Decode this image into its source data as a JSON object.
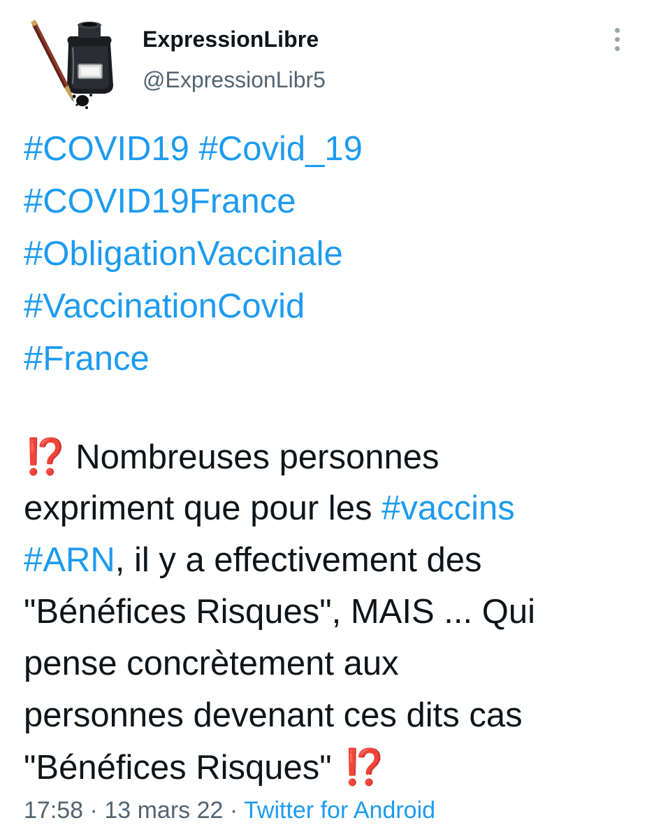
{
  "author": {
    "name": "ExpressionLibre",
    "handle": "@ExpressionLibr5",
    "avatar_icon": "fountain-pen-inkwell-icon"
  },
  "menu_icon": "more-vertical-icon",
  "colors": {
    "link": "#1d9bf0",
    "text": "#0f1419",
    "secondary": "#536471",
    "emoji": "#d0103a"
  },
  "hashtags": [
    [
      "#COVID19",
      "#Covid_19"
    ],
    [
      "#COVID19France"
    ],
    [
      "#ObligationVaccinale"
    ],
    [
      "#VaccinationCovid"
    ],
    [
      "#France"
    ]
  ],
  "body": {
    "emoji": "⁉️",
    "line1": "Nombreuses personnes",
    "line2_text": "expriment que pour les ",
    "line2_tag": "#vaccins",
    "line3_tag": "#ARN",
    "line3_text": ", il y a effectivement des",
    "line4": "\"Bénéfices Risques\", MAIS ... Qui",
    "line5": "pense concrètement aux",
    "line6": "personnes devenant ces dits cas",
    "line7": "\"Bénéfices Risques\""
  },
  "meta": {
    "time": "17:58",
    "date": "13 mars 22",
    "source": "Twitter for Android"
  }
}
